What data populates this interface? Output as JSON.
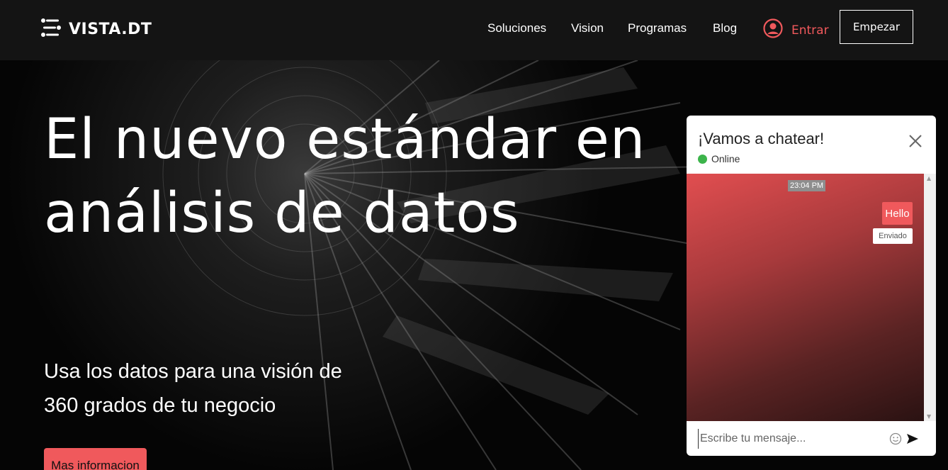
{
  "header": {
    "brand": "VISTA.DT",
    "nav": [
      {
        "label": "Soluciones"
      },
      {
        "label": "Vision"
      },
      {
        "label": "Programas"
      },
      {
        "label": "Blog"
      }
    ],
    "login_label": "Entrar",
    "cta_label": "Empezar"
  },
  "hero": {
    "title": "El nuevo estándar en análisis de datos",
    "subtitle": "Usa los datos para una visión de 360 grados de tu negocio",
    "button_label": "Mas informacion"
  },
  "chat": {
    "title": "¡Vamos a chatear!",
    "status": "Online",
    "timestamp": "23:04 PM",
    "message": "Hello",
    "message_status": "Enviado",
    "input_placeholder": "Escribe tu mensaje...",
    "colors": {
      "accent": "#f0595c",
      "online": "#3cb44b"
    }
  },
  "icons": {
    "logo": "logo-icon",
    "user": "user-icon",
    "close": "close-icon",
    "emoji": "emoji-icon",
    "send": "send-icon"
  }
}
